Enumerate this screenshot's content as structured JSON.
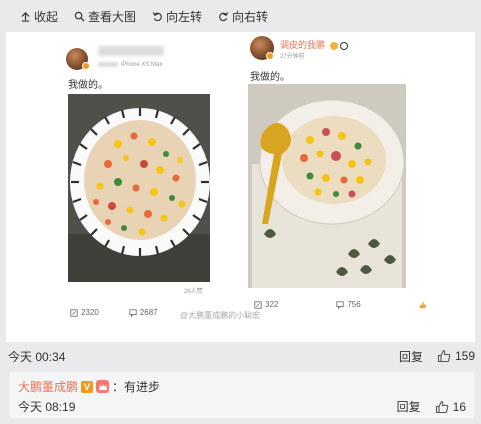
{
  "toolbar": {
    "collapse": "收起",
    "view_large": "查看大图",
    "rotate_left": "向左转",
    "rotate_right": "向右转"
  },
  "left_post": {
    "device": "iPhone XS Max",
    "text": "我做的。",
    "views": "26人赞",
    "repost_count": "2320",
    "comment_count": "2687"
  },
  "right_post": {
    "username": "调皮的我鹏",
    "time": "27分钟前",
    "text": "我做的。",
    "repost_count": "322",
    "comment_count": "756"
  },
  "watermark": "@大鹏董成鹏的小聪宏",
  "comment": {
    "time": "今天 00:34",
    "reply_label": "回复",
    "like_count": "159"
  },
  "subcomment": {
    "name": "大鹏董成鹏",
    "colon_text": "：有进步",
    "time": "今天 08:19",
    "reply_label": "回复",
    "like_count": "16"
  },
  "colors": {
    "accent": "#eb7350",
    "badge": "#f29a1a",
    "background": "#eaeaec"
  }
}
